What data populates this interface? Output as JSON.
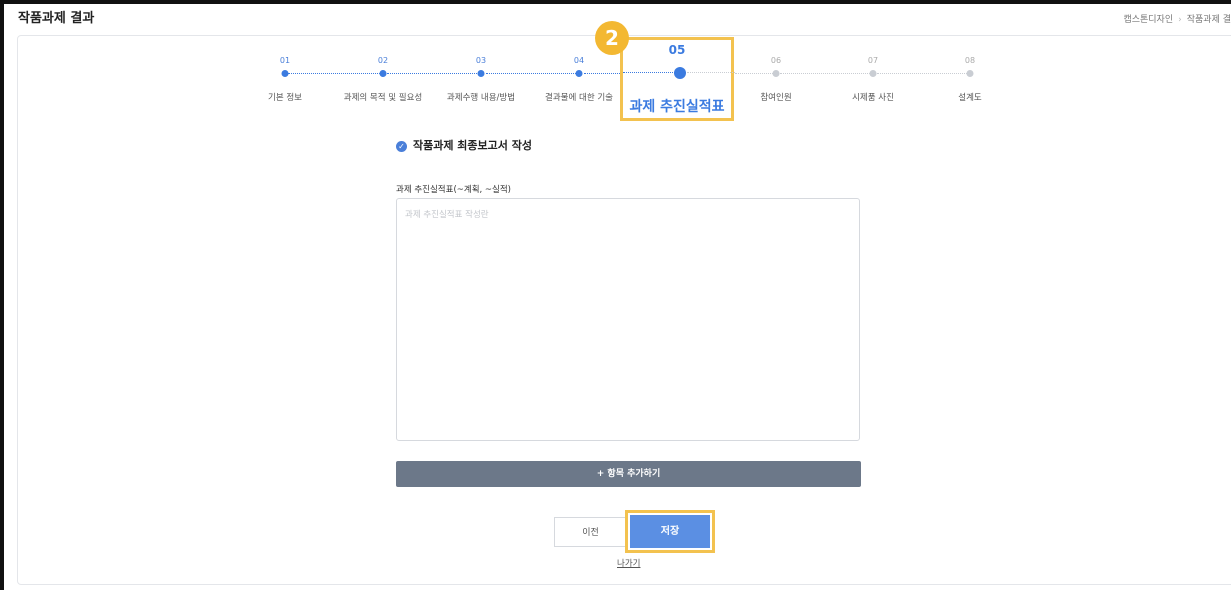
{
  "header": {
    "title": "작품과제 결과",
    "breadcrumb": [
      "캡스톤디자인",
      "작품과제 결"
    ]
  },
  "stepper": {
    "steps": [
      {
        "num": "01",
        "label": "기본 정보",
        "state": "done"
      },
      {
        "num": "02",
        "label": "과제의 목적 및 필요성",
        "state": "done"
      },
      {
        "num": "03",
        "label": "과제수행 내용/방법",
        "state": "done"
      },
      {
        "num": "04",
        "label": "결과물에 대한 기술",
        "state": "done"
      },
      {
        "num": "05",
        "label": "과제 추진실적표",
        "state": "current"
      },
      {
        "num": "06",
        "label": "참여인원",
        "state": "pending"
      },
      {
        "num": "07",
        "label": "시제품 사진",
        "state": "pending"
      },
      {
        "num": "08",
        "label": "설계도",
        "state": "pending"
      }
    ],
    "callout_badge": "2"
  },
  "form": {
    "section_title": "작품과제 최종보고서 작성",
    "field_label": "과제 추진실적표(~계획, ~실적)",
    "textarea_placeholder": "과제 추진실적표 작성란",
    "textarea_value": "",
    "add_button_label": "+ 항목 추가하기"
  },
  "actions": {
    "prev_label": "이전",
    "save_label": "저장",
    "exit_label": "나가기"
  },
  "colors": {
    "accent": "#3b7be0",
    "highlight": "#f3c24f",
    "badge": "#f3b832",
    "add_button": "#6c7889"
  }
}
